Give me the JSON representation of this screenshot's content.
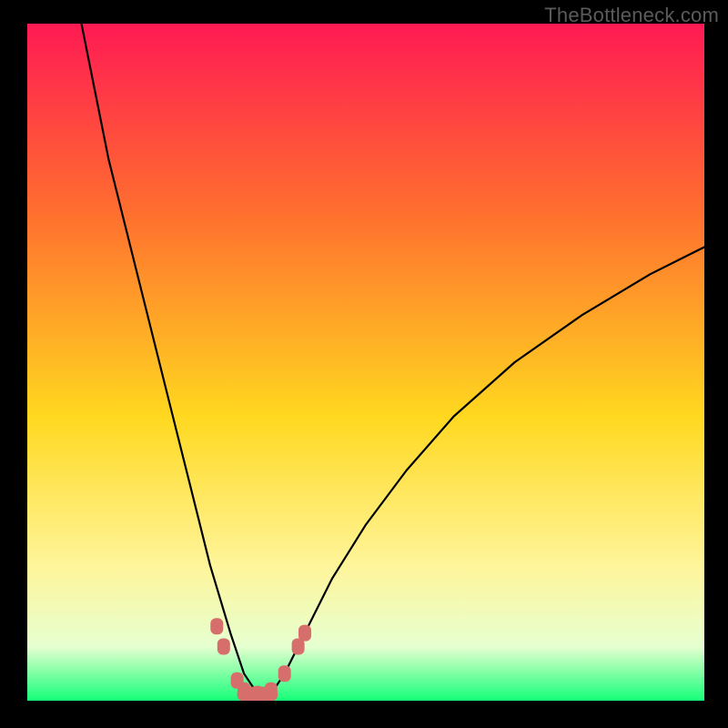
{
  "watermark": "TheBottleneck.com",
  "colors": {
    "frame": "#000000",
    "gradient_top": "#ff1a53",
    "gradient_mid_upper": "#ff6f2f",
    "gradient_mid": "#ffd81f",
    "gradient_lower": "#fff59a",
    "gradient_pale": "#e6ffd0",
    "gradient_bottom": "#15ff79",
    "curve": "#000000",
    "markers": "#d66e6b"
  },
  "chart_data": {
    "type": "line",
    "title": "",
    "xlabel": "",
    "ylabel": "",
    "xlim": [
      0,
      100
    ],
    "ylim": [
      0,
      100
    ],
    "grid": false,
    "legend": false,
    "series": [
      {
        "name": "bottleneck-curve",
        "comment": "V-shaped curve from top-left down to trough near x≈33 then rising to right edge",
        "x": [
          8,
          10,
          12,
          15,
          18,
          21,
          24,
          27,
          30,
          32,
          34,
          36,
          38,
          41,
          45,
          50,
          56,
          63,
          72,
          82,
          92,
          100
        ],
        "y": [
          100,
          90,
          80,
          68,
          56,
          44,
          32,
          20,
          10,
          4,
          1,
          1,
          4,
          10,
          18,
          26,
          34,
          42,
          50,
          57,
          63,
          67
        ]
      }
    ],
    "markers": {
      "name": "trough-markers",
      "comment": "Salmon-colored segment markers clustered at/near the minimum of the V",
      "points": [
        {
          "x": 28,
          "y": 11
        },
        {
          "x": 29,
          "y": 8
        },
        {
          "x": 31,
          "y": 3
        },
        {
          "x": 32,
          "y": 1.5
        },
        {
          "x": 34,
          "y": 1
        },
        {
          "x": 36,
          "y": 1.5
        },
        {
          "x": 38,
          "y": 4
        },
        {
          "x": 40,
          "y": 8
        },
        {
          "x": 41,
          "y": 10
        }
      ]
    }
  }
}
